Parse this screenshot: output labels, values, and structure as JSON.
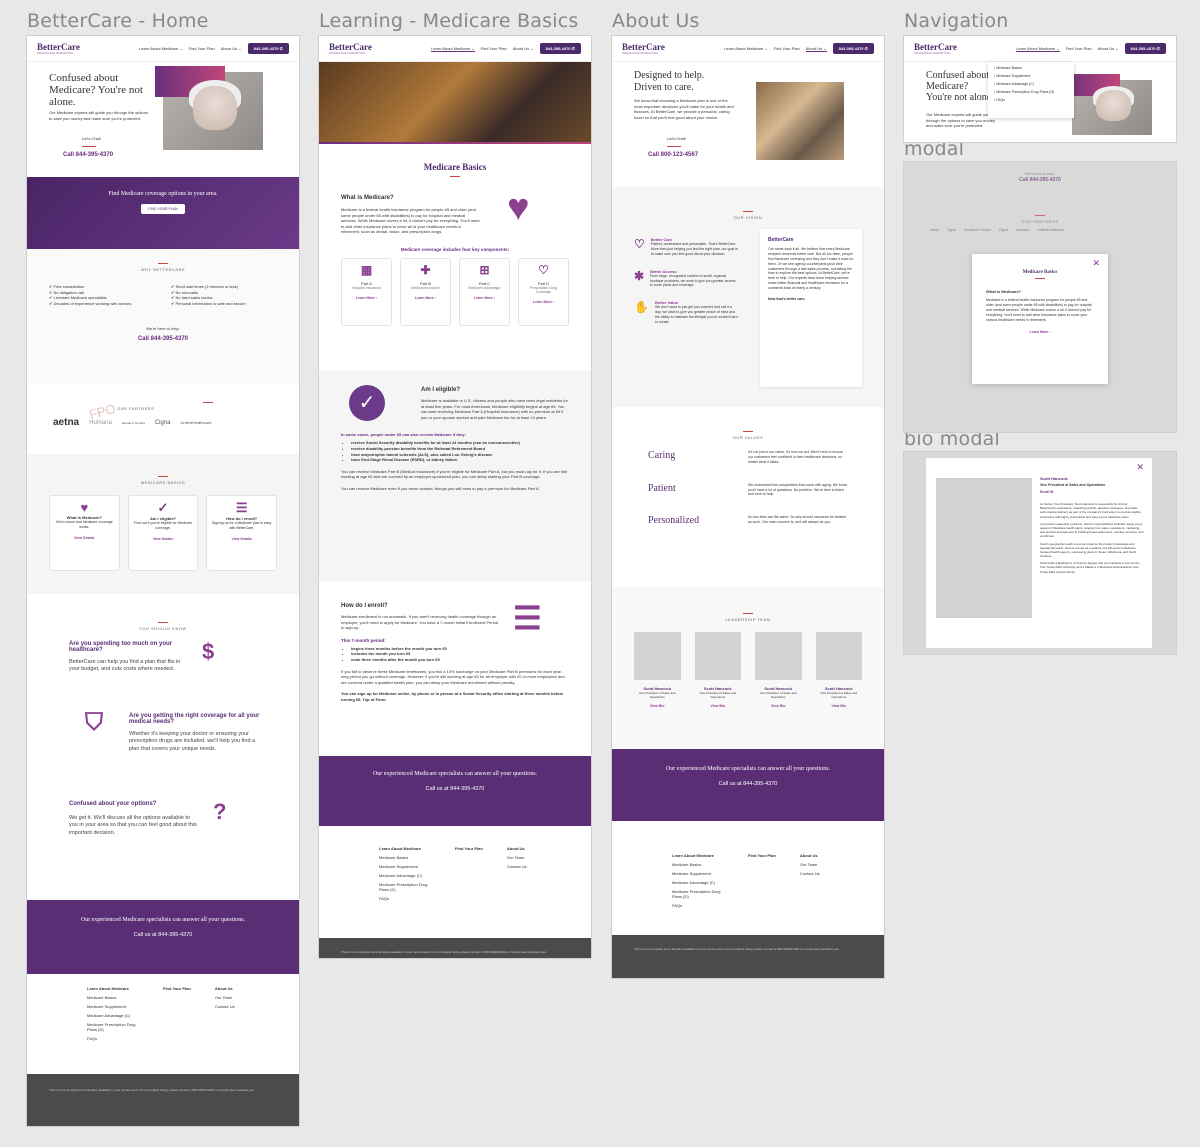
{
  "frames": {
    "home": "BetterCare - Home",
    "learning": "Learning - Medicare Basics",
    "about": "About Us",
    "navigation": "Navigation",
    "modal": "modal",
    "bio_modal": "bio modal"
  },
  "nav": {
    "logo": "BetterCare",
    "logo_sub": "INSURANCE MARKETING",
    "items": [
      "Learn About Medicare ⌄",
      "Find Your Plan",
      "About Us ⌄"
    ],
    "phone": "844-395-4370 ✆",
    "dropdown": [
      "Medicare Basics",
      "Medicare Supplement",
      "Medicare Advantage (C)",
      "Medicare Prescription Drug Plans (D)",
      "FAQs"
    ]
  },
  "home": {
    "hero_title": "Confused about Medicare? You're not alone.",
    "hero_text": "Our Medicare experts will guide you through the options to save you money and make sure you're protected.",
    "lets_chat": "Let's Chat!",
    "call": "Call 844-395-4370",
    "band_title": "Find Medicare coverage options in your area.",
    "band_button": "FIND YOUR PLAN",
    "why_label": "WHY BETTERCARE",
    "why_left": [
      "Free consultation",
      "No obligation call",
      "Licensed Medicare specialists",
      "Decades of experience working with seniors"
    ],
    "why_right": [
      "Short wait times (5 minutes or less)",
      "No robocalls",
      "No hard sales tactics",
      "Personal information is safe and secure"
    ],
    "help": "We're here to help.",
    "help_call": "Call 844-395-4370",
    "partners_label": "OUR PARTNERS",
    "partners": [
      "aetna",
      "Humana",
      "Mutual of Omaha",
      "Cigna",
      "UnitedHealthcare"
    ],
    "fpo": "FPO",
    "basics_label": "MEDICARE BASICS",
    "basics_cards": [
      {
        "title": "What is Medicare?",
        "text": "Get to know how Medicare coverage works.",
        "link": "View Details"
      },
      {
        "title": "Am I eligible?",
        "text": "Find out if you're eligible for Medicare coverage.",
        "link": "View Details"
      },
      {
        "title": "How do I enroll?",
        "text": "Signing up for a Medicare plan is easy with BetterCare.",
        "link": "View Details"
      }
    ],
    "know_label": "YOU SHOULD KNOW",
    "know": [
      {
        "q": "Are you spending too much on your healthcare?",
        "a": "BetterCare can help you find a plan that fits in your budget, and cuts costs where needed."
      },
      {
        "q": "Are you getting the right coverage for all your medical needs?",
        "a": "Whether it's keeping your doctor or ensuring your prescription drugs are included, we'll help you find a plan that covers your unique needs."
      },
      {
        "q": "Confused about your options?",
        "a": "We get it. We'll discuss all the options available to you in your area so that you can feel good about this important decision."
      }
    ],
    "cta_title": "Our experienced Medicare specialists can answer all your questions.",
    "cta_call": "Call us at 844-395-4370"
  },
  "footer": {
    "col1": [
      "Learn About Medicare",
      "Medicare Basics",
      "Medicare Supplement",
      "Medicare Advantage (C)",
      "Medicare Prescription Drug Plans (D)",
      "FAQs"
    ],
    "col2": [
      "Find Your Plan"
    ],
    "col3": [
      "About Us",
      "Our Team",
      "Contact Us"
    ]
  },
  "learning": {
    "title": "Medicare Basics",
    "what_title": "What is Medicare?",
    "what_text": "Medicare is a federal health insurance program for people 65 and older (and some people under 65 with disabilities) to pay for hospital and medical services. While Medicare covers a lot, it doesn't pay for everything. You'll need to add other insurance plans to cover all of your healthcare needs in retirement, such as dental, vision, and prescription drugs.",
    "parts_title": "Medicare coverage includes four key components:",
    "parts": [
      {
        "name": "Part A",
        "desc": "Hospital Insurance"
      },
      {
        "name": "Part B",
        "desc": "Medical Insurance"
      },
      {
        "name": "Part C",
        "desc": "Medicare Advantage"
      },
      {
        "name": "Part D",
        "desc": "Prescription Drug Coverage"
      }
    ],
    "learn_more": "Learn More ›",
    "elig_title": "Am I eligible?",
    "elig_text": "Medicare is available to U.S. citizens and people who have been legal residents for at least five years. For most Americans, Medicare eligibility begins at age 65. You can start receiving Medicare Part A (Hospital Insurance) with no premium at 65 if you or your spouse worked and paid Medicare tax for at least 10 years.",
    "cases_title": "In some cases, people under 65 can also receive Medicare if they:",
    "cases": [
      "receive Social Security disability benefits for at least 24 months (can be nonconsecutive)",
      "receive disability pension benefits from the Railroad Retirement Board",
      "have amyotrophic lateral sclerosis (ALS), also called Lou Gehrig's disease",
      "have End-Stage Renal Disease (ESRD), or kidney failure."
    ],
    "elig_p2": "You can receive Medicare Part B (Medical Insurance) if you're eligible for Medicare Part A, but you must pay for it. If you are still working at age 65 and are covered by an employer-sponsored plan, you can delay starting your Part B coverage.",
    "elig_p3": "You can receive Medicare even if you never worked, though you will need to pay a premium for Medicare Part A.",
    "enroll_title": "How do I enroll?",
    "enroll_text": "Medicare enrollment is not automatic. If you aren't receiving health coverage through an employer, you'll need to apply for Medicare. You have a 7-month Initial Enrollment Period to sign up.",
    "period_title": "This 7-month period:",
    "period": [
      "begins three months before the month you turn 65",
      "includes the month you turn 65",
      "ends three months after the month you turn 65"
    ],
    "enroll_p2": "If you fail to observe these Medicare timeframes, you risk a 10% surcharge on your Medicare Part B premiums for each year-long period you go without coverage. However, if you're still working at age 65 for an employer with 20 or more employees and are covered under a qualified health plan, you can delay your Medicare enrollment without penalty.",
    "enroll_p3": "You can sign up for Medicare online, by phone or in person at a Social Security office starting at three months before turning 65. Top of Form."
  },
  "about": {
    "hero_title": "Designed to help. Driven to care.",
    "hero_text": "We know that choosing a Medicare plan is one of the most important decisions you'll make for your health and finances. At BetterCare, we provide a personal, caring touch so that you'll feel good about your choice.",
    "lets_chat": "Let's Chat!",
    "call": "Call 800-123-4567",
    "vision_label": "OUR VISION",
    "vision": [
      {
        "title": "Better Care",
        "text": "Patient, understand and personable. That's BetterCare. More than just helping you find the right plan, our goal is to make sure you feel good about your decision."
      },
      {
        "title": "Better Access",
        "text": "From large, recognized carriers to small, regional boutique providers, we work to give you greater access to more plans and coverage."
      },
      {
        "title": "Better Value",
        "text": "We don't want to just get you covered and call it a day; we want to give you greater peace of mind and the ability to maintain the lifestyle you've worked hard to create."
      }
    ],
    "vision_card_title": "BetterCare",
    "vision_card_text": "Our name says it all. We believe that every Medicare recipient deserves better care. But all too often, people find Medicare confusing and they don't make it work for them. Or we see agency counterparts push their customers through a fast sales process, not taking the time to explore the best options. At BetterCare, we're here to help. Our experts have been helping seniors make better financial and healthcare decisions for a combined total of nearly a century.",
    "vision_card_end": "Now that's better care.",
    "values_label": "OUR VALUES",
    "values": [
      {
        "name": "Caring",
        "text": "It's not just in our name, it's how we act. We're here to ensure our customers feel confident in their healthcare decisions, no matter what it takes."
      },
      {
        "name": "Patient",
        "text": "We understand the complexities that come with aging. We know you'll have a lot of questions. No problem. We're here to listen and here to help."
      },
      {
        "name": "Personalized",
        "text": "No two lives are the same. So why should insurance be treated as such. Our main concern is, and will always be you."
      }
    ],
    "team_label": "LEADERSHIP TEAM",
    "team": [
      {
        "name": "Scott Hancock",
        "role": "Vice President of Sales and Operations",
        "link": "View Bio"
      },
      {
        "name": "Scott Hancock",
        "role": "Vice President of Sales and Operations",
        "link": "View Bio"
      },
      {
        "name": "Scott Hancock",
        "role": "Vice President of Sales and Operations",
        "link": "View Bio"
      },
      {
        "name": "Scott Hancock",
        "role": "Vice President of Sales and Operations",
        "link": "View Bio"
      }
    ]
  },
  "modal": {
    "title": "Medicare Basics",
    "subtitle": "What is Medicare?",
    "text": "Medicare is a federal health insurance program for people 65 and older (and some people under 65 with disabilities) to pay for hospital and medical services. While Medicare covers a lot, it doesn't pay for everything. You'll need to add other insurance plans to cover your various healthcare needs in retirement.",
    "link": "Learn More ›",
    "bg_help": "We're here to help.",
    "bg_call": "Call 844-395-4370",
    "bg_partners": "OUR PARTNERS"
  },
  "bio": {
    "name": "Scott Hancock",
    "role": "Vice President of Sales and Operations",
    "email": "Email ✉",
    "p1": "As Senior Vice President, Scott Hancock is responsible for driving BetterCare's operations, marketing growth, adoption strategies, and sales performance delivery as part of the company's bold vision to provide eligible Americans with highly customized and easy-to-use Medicare plans.",
    "p2": "In previous leadership positions, Scott's responsibilities included nearly every aspect of Medicare health plans, ranging from sales, operations, marketing, and product development to building broad awareness, member services, and enrollment.",
    "p3": "Scott's geographic reach is just as broad as his product knowledge and operational reach. He has served as president of a full-service Medicare-focused health agency, overseeing plans in Texas, Oklahoma, and North Carolina.",
    "p4": "Scott holds a Bachelor's of Science degree with an emphasis in economics from Texas A&M University and a Master's in Business Administration from Texas A&M Corpus Christi."
  },
  "disclaimer": "This is not a complete list of all plans available in your service area. For a complete listing, please contact 1-800-MEDICARE or consult www.medicare.gov."
}
